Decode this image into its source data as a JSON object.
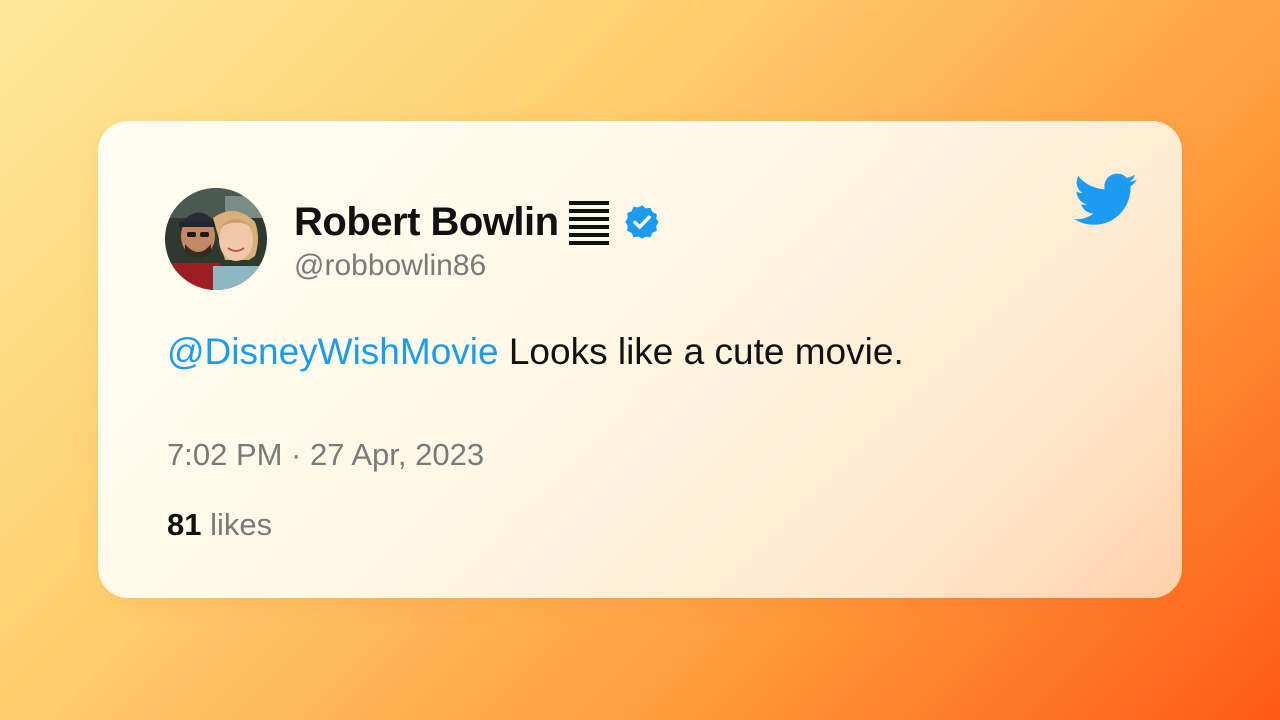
{
  "tweet": {
    "author": {
      "display_name": "Robert Bowlin",
      "handle": "@robbowlin86",
      "verified": true,
      "avatar": "profile-photo"
    },
    "text": {
      "mention": "@DisneyWishMovie",
      "body": " Looks like a cute movie."
    },
    "timestamp": "7:02 PM · 27 Apr, 2023",
    "likes": {
      "count": "81",
      "label": " likes"
    }
  },
  "icons": {
    "brand": "twitter-bird-icon",
    "verified": "verified-badge-icon",
    "flag": "flag-emoji-icon"
  },
  "colors": {
    "brand_blue": "#1d9bf0",
    "text_primary": "#111111",
    "text_secondary": "#7a7a7a"
  }
}
